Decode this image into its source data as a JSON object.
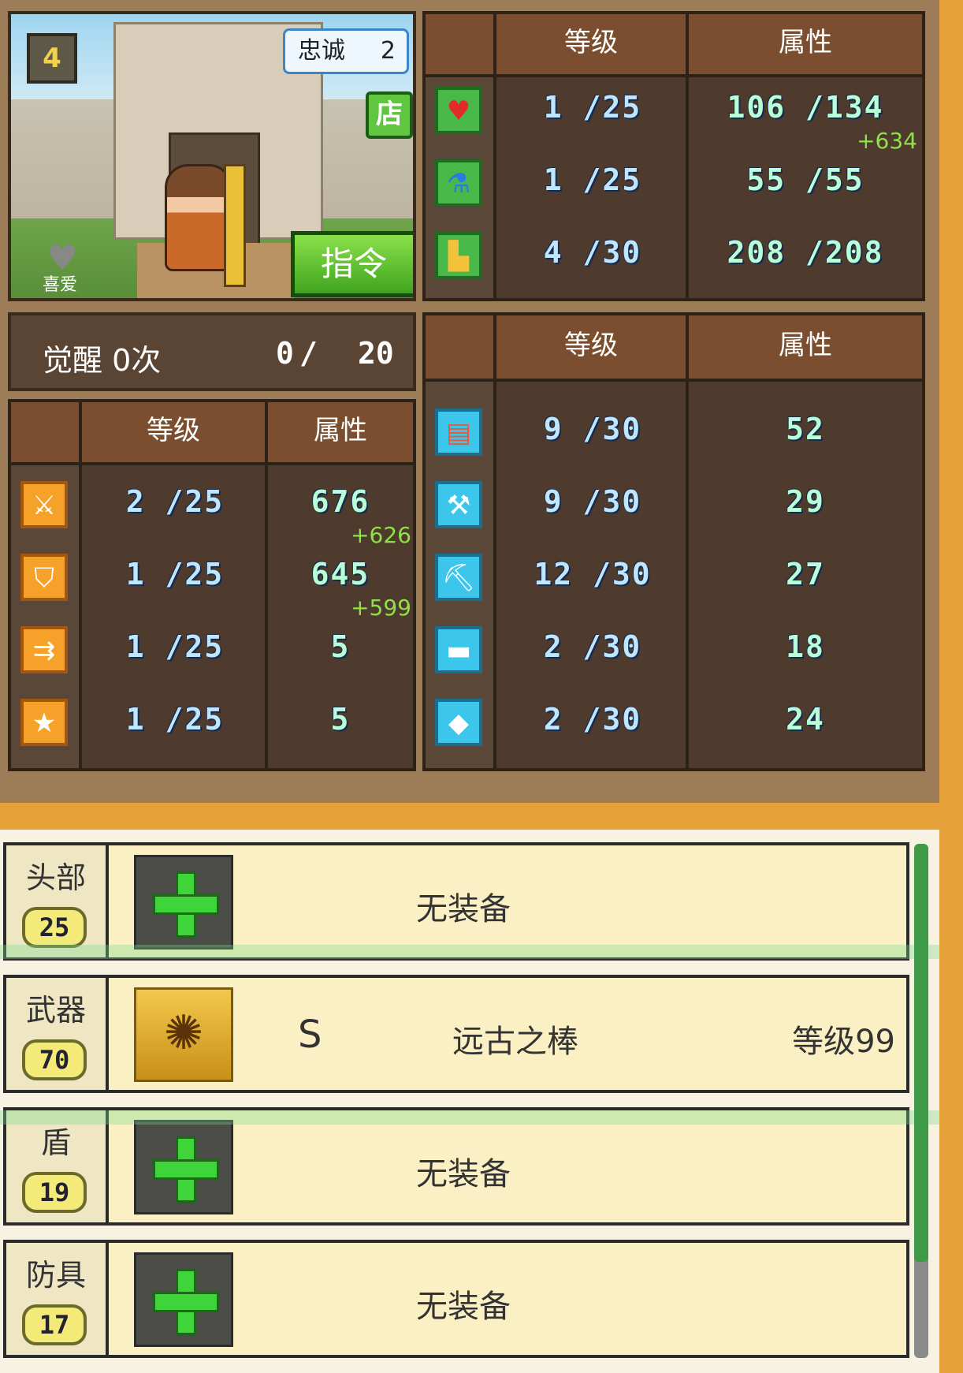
{
  "portrait": {
    "loyalty_label": "忠诚",
    "loyalty_value": "2",
    "rank_icon_text": "4",
    "shop_label": "店",
    "favorite_label": "喜爱",
    "command_label": "指令"
  },
  "awaken": {
    "label": "觉醒 0次",
    "current": "0",
    "slash": "/",
    "max": "20"
  },
  "vital_stats": {
    "header_level": "等级",
    "header_attr": "属性",
    "rows": [
      {
        "icon": "heart-icon",
        "level": "1 /25",
        "attr": "106 /134",
        "bonus": "+634"
      },
      {
        "icon": "potion-icon",
        "level": "1 /25",
        "attr": "55 /55",
        "bonus": ""
      },
      {
        "icon": "boot-icon",
        "level": "4 /30",
        "attr": "208 /208",
        "bonus": ""
      }
    ]
  },
  "combat_stats": {
    "header_level": "等级",
    "header_attr": "属性",
    "rows": [
      {
        "icon": "sword-icon",
        "level": "2 /25",
        "attr": "676",
        "bonus": "+626"
      },
      {
        "icon": "shield-icon",
        "level": "1 /25",
        "attr": "645",
        "bonus": "+599"
      },
      {
        "icon": "arrows-icon",
        "level": "1 /25",
        "attr": "5",
        "bonus": ""
      },
      {
        "icon": "star-icon",
        "level": "1 /25",
        "attr": "5",
        "bonus": ""
      }
    ]
  },
  "craft_stats": {
    "header_level": "等级",
    "header_attr": "属性",
    "rows": [
      {
        "icon": "book-icon",
        "level": "9 /30",
        "attr": "52"
      },
      {
        "icon": "hammer-icon",
        "level": "9 /30",
        "attr": "29"
      },
      {
        "icon": "pickaxe-icon",
        "level": "12 /30",
        "attr": "27"
      },
      {
        "icon": "anvil-icon",
        "level": "2 /30",
        "attr": "18"
      },
      {
        "icon": "ore-icon",
        "level": "2 /30",
        "attr": "24"
      }
    ]
  },
  "equipment": [
    {
      "slot": "头部",
      "level": "25",
      "empty_text": "无装备"
    },
    {
      "slot": "武器",
      "level": "70",
      "grade": "S",
      "name": "远古之棒",
      "item_level": "等级99"
    },
    {
      "slot": "盾",
      "level": "19",
      "empty_text": "无装备"
    },
    {
      "slot": "防具",
      "level": "17",
      "empty_text": "无装备"
    }
  ],
  "colors": {
    "panel_brown": "#4e3b2e",
    "header_brown": "#7a4e2e",
    "accent_orange": "#e6a238",
    "bonus_green": "#8fe04a",
    "slot_bg": "#fbf0c4"
  }
}
